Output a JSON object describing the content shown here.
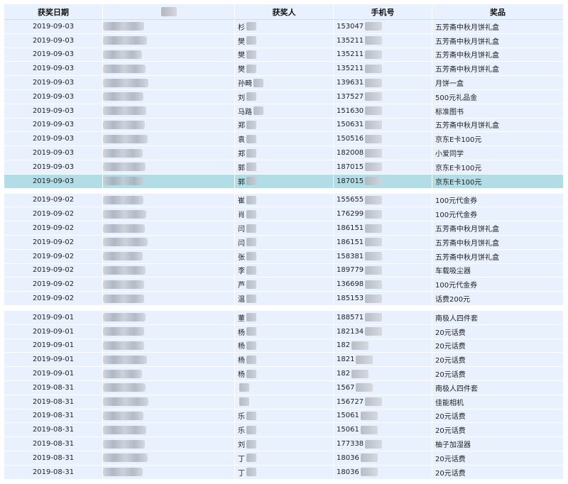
{
  "headers": {
    "date": "获奖日期",
    "winner": "获奖人",
    "phone": "手机号",
    "prize": "奖品"
  },
  "groups": [
    {
      "rows": [
        {
          "date": "2019-09-03",
          "name": "杉",
          "phone": "153047",
          "prize": "五芳斋中秋月饼礼盒"
        },
        {
          "date": "2019-09-03",
          "name": "樊",
          "phone": "135211",
          "prize": "五芳斋中秋月饼礼盒"
        },
        {
          "date": "2019-09-03",
          "name": "樊",
          "phone": "135211",
          "prize": "五芳斋中秋月饼礼盒"
        },
        {
          "date": "2019-09-03",
          "name": "樊",
          "phone": "135211",
          "prize": "五芳斋中秋月饼礼盒"
        },
        {
          "date": "2019-09-03",
          "name": "孙畸",
          "phone": "139631",
          "prize": "月饼一盒"
        },
        {
          "date": "2019-09-03",
          "name": "刘",
          "phone": "137527",
          "prize": "500元礼品金"
        },
        {
          "date": "2019-09-03",
          "name": "马路",
          "phone": "151630",
          "prize": "标准图书"
        },
        {
          "date": "2019-09-03",
          "name": "郑",
          "phone": "150631",
          "prize": "五芳斋中秋月饼礼盒"
        },
        {
          "date": "2019-09-03",
          "name": "袁",
          "phone": "150516",
          "prize": "京东E卡100元"
        },
        {
          "date": "2019-09-03",
          "name": "郑",
          "phone": "182008",
          "prize": "小爱同学"
        },
        {
          "date": "2019-09-03",
          "name": "郭",
          "phone": "187015",
          "prize": "京东E卡100元"
        },
        {
          "date": "2019-09-03",
          "name": "郭",
          "phone": "187015",
          "prize": "京东E卡100元",
          "highlight": true
        }
      ]
    },
    {
      "rows": [
        {
          "date": "2019-09-02",
          "name": "崔",
          "phone": "155655",
          "prize": "100元代金券"
        },
        {
          "date": "2019-09-02",
          "name": "肖",
          "phone": "176299",
          "prize": "100元代金券"
        },
        {
          "date": "2019-09-02",
          "name": "闫",
          "phone": "186151",
          "prize": "五芳斋中秋月饼礼盒"
        },
        {
          "date": "2019-09-02",
          "name": "闫",
          "phone": "186151",
          "prize": "五芳斋中秋月饼礼盒"
        },
        {
          "date": "2019-09-02",
          "name": "张",
          "phone": "158381",
          "prize": "五芳斋中秋月饼礼盒"
        },
        {
          "date": "2019-09-02",
          "name": "李",
          "phone": "189779",
          "prize": "车载吸尘器"
        },
        {
          "date": "2019-09-02",
          "name": "芦",
          "phone": "136698",
          "prize": "100元代金券"
        },
        {
          "date": "2019-09-02",
          "name": "温",
          "phone": "185153",
          "prize": "话费200元"
        }
      ]
    },
    {
      "rows": [
        {
          "date": "2019-09-01",
          "name": "董",
          "phone": "188571",
          "prize": "南极人四件套"
        },
        {
          "date": "2019-09-01",
          "name": "杨",
          "phone": "182134",
          "prize": "20元话费"
        },
        {
          "date": "2019-09-01",
          "name": "杨",
          "phone": "182",
          "prize": "20元话费"
        },
        {
          "date": "2019-09-01",
          "name": "杨",
          "phone": "1821",
          "prize": "20元话费"
        },
        {
          "date": "2019-09-01",
          "name": "杨",
          "phone": "182",
          "prize": "20元话费"
        },
        {
          "date": "2019-08-31",
          "name": "",
          "phone": "1567",
          "prize": "南极人四件套"
        },
        {
          "date": "2019-08-31",
          "name": "",
          "phone": "156727",
          "prize": "佳能相机"
        },
        {
          "date": "2019-08-31",
          "name": "乐",
          "phone": "15061",
          "prize": "20元话费"
        },
        {
          "date": "2019-08-31",
          "name": "乐",
          "phone": "15061",
          "prize": "20元话费"
        },
        {
          "date": "2019-08-31",
          "name": "刘",
          "phone": "177338",
          "prize": "柚子加湿器"
        },
        {
          "date": "2019-08-31",
          "name": "丁",
          "phone": "18036",
          "prize": "20元话费"
        },
        {
          "date": "2019-08-31",
          "name": "丁",
          "phone": "18036",
          "prize": "20元话费"
        }
      ]
    }
  ]
}
